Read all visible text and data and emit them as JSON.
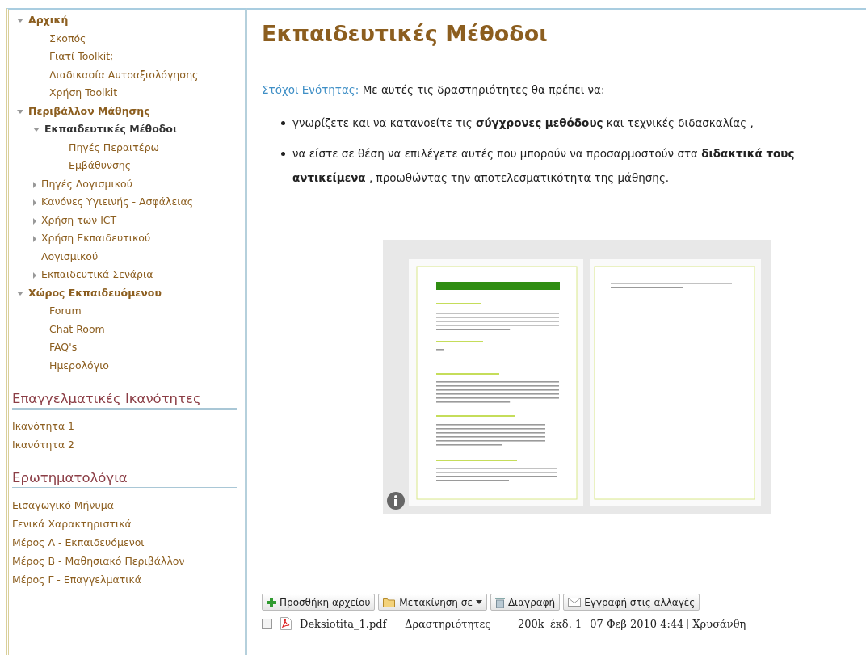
{
  "sidebar": {
    "tree": [
      {
        "label": "Αρχική",
        "kind": "branch",
        "expanded": true,
        "selected": false,
        "children": [
          {
            "label": "Σκοπός",
            "kind": "leaf",
            "selected": false
          },
          {
            "label": "Γιατί Toolkit;",
            "kind": "leaf",
            "selected": false
          },
          {
            "label": "Διαδικασία Αυτοαξιολόγησης",
            "kind": "leaf",
            "selected": false
          },
          {
            "label": "Χρήση Toolkit",
            "kind": "leaf",
            "selected": false
          }
        ]
      },
      {
        "label": "Περιβάλλον Μάθησης",
        "kind": "branch",
        "expanded": true,
        "selected": false,
        "children": [
          {
            "label": "Εκπαιδευτικές Μέθοδοι",
            "kind": "branch",
            "expanded": true,
            "selected": true,
            "children": [
              {
                "label": "Πηγές Περαιτέρω Εμβάθυνσης",
                "selected": false
              }
            ]
          },
          {
            "label": "Πηγές Λογισμικού",
            "kind": "branch",
            "expanded": false,
            "selected": false
          },
          {
            "label": "Κανόνες Υγιεινής - Ασφάλειας",
            "kind": "branch",
            "expanded": false,
            "selected": false
          },
          {
            "label": "Χρήση των ICT",
            "kind": "branch",
            "expanded": false,
            "selected": false
          },
          {
            "label": "Χρήση Εκπαιδευτικού Λογισμικού",
            "kind": "branch",
            "expanded": false,
            "selected": false
          },
          {
            "label": "Εκπαιδευτικά Σενάρια",
            "kind": "branch",
            "expanded": false,
            "selected": false
          }
        ]
      },
      {
        "label": "Χώρος Εκπαιδευόμενου",
        "kind": "branch",
        "expanded": true,
        "selected": false,
        "children": [
          {
            "label": "Forum",
            "kind": "leaf",
            "selected": false
          },
          {
            "label": "Chat Room",
            "kind": "leaf",
            "selected": false
          },
          {
            "label": "FAQ's",
            "kind": "leaf",
            "selected": false
          },
          {
            "label": "Ημερολόγιο",
            "kind": "leaf",
            "selected": false
          }
        ]
      }
    ],
    "sections": [
      {
        "heading": "Επαγγελματικές Ικανότητες",
        "links": [
          "Ικανότητα 1",
          "Ικανότητα 2"
        ]
      },
      {
        "heading": "Ερωτηματολόγια",
        "links": [
          "Εισαγωγικό Μήνυμα",
          "Γενικά Χαρακτηριστικά",
          "Μέρος Α - Εκπαιδευόμενοι",
          "Μέρος Β - Μαθησιακό Περιβάλλον",
          "Μέρος Γ - Επαγγελματικά"
        ]
      }
    ]
  },
  "main": {
    "title": "Εκπαιδευτικές Μέθοδοι",
    "objectives_label": "Στόχοι Ενότητας:",
    "objectives_text": "Με αυτές τις δραστηριότητες θα πρέπει να:",
    "bullets": [
      "γνωρίζετε και να κατανοείτε τις **σύγχρονες μεθόδους** και τεχνικές διδασκαλίας ,",
      "να είστε σε θέση να επιλέγετε αυτές που μπορούν να προσαρμοστούν στα **διδακτικά τους αντικείμενα** , προωθώντας την αποτελεσματικότητα της μάθησης."
    ],
    "toolbar": [
      {
        "kind": "add",
        "label": "Προσθήκη αρχείου"
      },
      {
        "kind": "move",
        "label": "Μετακίνηση σε"
      },
      {
        "kind": "delete",
        "label": "Διαγραφή"
      },
      {
        "kind": "subscribe",
        "label": "Εγγραφή στις αλλαγές"
      }
    ],
    "files": [
      {
        "checked": false,
        "name": "Deksiotita_1.pdf",
        "folder": "Δραστηριότητες",
        "size": "200k",
        "version": "έκδ. 1",
        "date": "07 Φεβ 2010 4:44",
        "author": "Χρυσάνθη"
      }
    ]
  }
}
